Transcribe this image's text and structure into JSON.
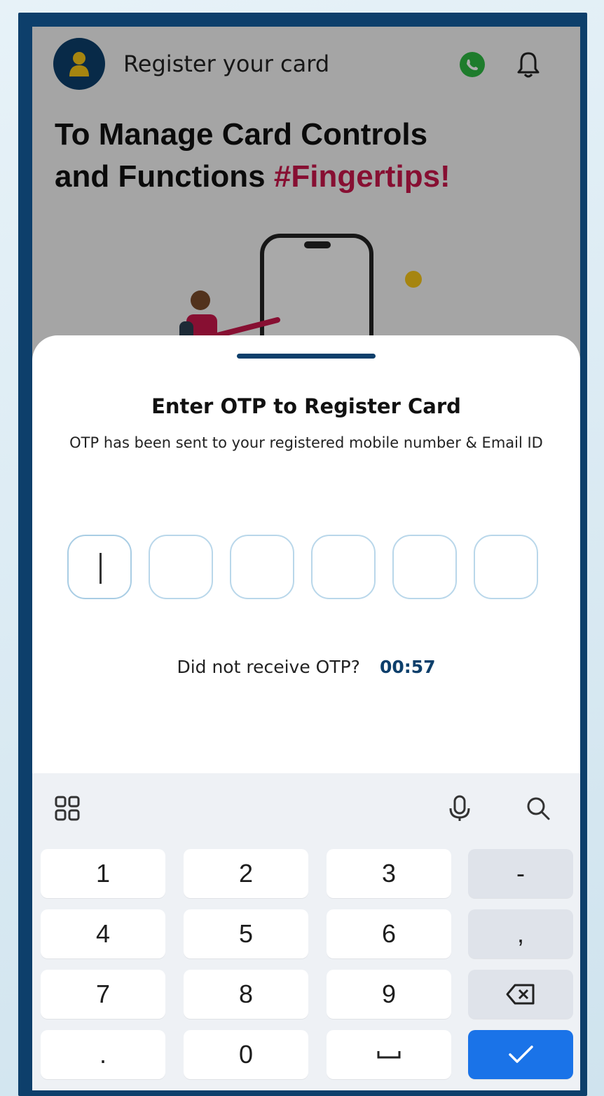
{
  "header": {
    "title": "Register your card",
    "avatar_icon": "user-icon",
    "whatsapp_icon": "whatsapp-icon",
    "bell_icon": "bell-icon"
  },
  "banner": {
    "headline_line1": "To Manage Card Controls",
    "headline_line2_prefix": "and Functions ",
    "headline_accent": "#Fingertips!",
    "accent_color": "#c8174b"
  },
  "sheet": {
    "title": "Enter OTP to Register Card",
    "subtitle": "OTP has been sent to your registered mobile number & Email ID",
    "otp_length": 6,
    "resend_label": "Did not receive OTP?",
    "timer": "00:57"
  },
  "keyboard": {
    "toolbar": {
      "apps_icon": "grid-icon",
      "mic_icon": "microphone-icon",
      "search_icon": "search-icon"
    },
    "rows": [
      [
        "1",
        "2",
        "3",
        "-"
      ],
      [
        "4",
        "5",
        "6",
        ","
      ],
      [
        "7",
        "8",
        "9",
        "⌫"
      ],
      [
        ".",
        "0",
        "␣",
        "✓"
      ]
    ]
  },
  "colors": {
    "brand": "#0d3f6b",
    "primary_button": "#1a73e8"
  }
}
